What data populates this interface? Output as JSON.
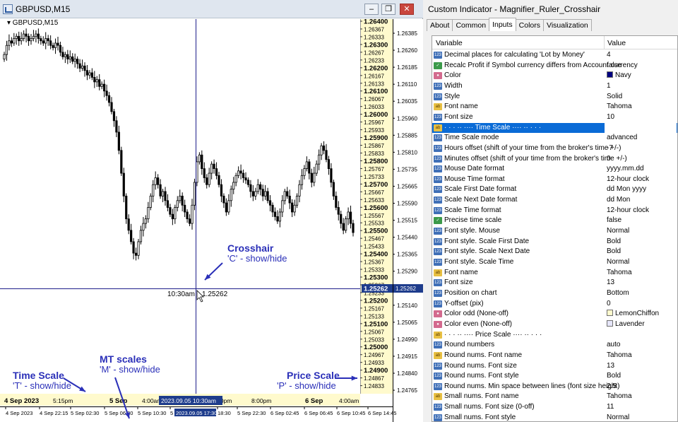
{
  "chart": {
    "window_title": "GBPUSD,M15",
    "symbol_label": "▾ GBPUSD,M15",
    "buttons": {
      "minimize": "–",
      "restore": "❐",
      "close": "✕"
    },
    "crosshair_time": "10:30am",
    "crosshair_price": "1.25262",
    "price_tag": "1.25262",
    "right_price_tag": "1.25262",
    "scale_marker": "2023.09.05 10:30am",
    "mt_marker": "2023.09.05 17:30",
    "custom_time_labels": [
      {
        "text": "4 Sep 2023",
        "bold": true
      },
      {
        "text": "5:15pm",
        "bold": false
      },
      {
        "text": "5 Sep",
        "bold": true
      },
      {
        "text": "4:00am",
        "bold": false
      },
      {
        "text": "4:00pm",
        "bold": false
      },
      {
        "text": "8:00pm",
        "bold": false
      },
      {
        "text": "6 Sep",
        "bold": true
      },
      {
        "text": "4:00am",
        "bold": false
      },
      {
        "text": "8:00am",
        "bold": false
      }
    ],
    "mt_time_labels": [
      "4 Sep 2023",
      "4 Sep 22:15",
      "5 Sep 02:30",
      "5 Sep 06:30",
      "5 Sep 10:30",
      "5",
      "18:30",
      "5 Sep 22:30",
      "6 Sep 02:45",
      "6 Sep 06:45",
      "6 Sep 10:45",
      "6 Sep 14:45"
    ],
    "custom_price_labels": [
      {
        "text": "1.26400",
        "bold": true
      },
      {
        "text": "1.26367",
        "bold": false
      },
      {
        "text": "1.26333",
        "bold": false
      },
      {
        "text": "1.26300",
        "bold": true
      },
      {
        "text": "1.26267",
        "bold": false
      },
      {
        "text": "1.26233",
        "bold": false
      },
      {
        "text": "1.26200",
        "bold": true
      },
      {
        "text": "1.26167",
        "bold": false
      },
      {
        "text": "1.26133",
        "bold": false
      },
      {
        "text": "1.26100",
        "bold": true
      },
      {
        "text": "1.26067",
        "bold": false
      },
      {
        "text": "1.26033",
        "bold": false
      },
      {
        "text": "1.26000",
        "bold": true
      },
      {
        "text": "1.25967",
        "bold": false
      },
      {
        "text": "1.25933",
        "bold": false
      },
      {
        "text": "1.25900",
        "bold": true
      },
      {
        "text": "1.25867",
        "bold": false
      },
      {
        "text": "1.25833",
        "bold": false
      },
      {
        "text": "1.25800",
        "bold": true
      },
      {
        "text": "1.25767",
        "bold": false
      },
      {
        "text": "1.25733",
        "bold": false
      },
      {
        "text": "1.25700",
        "bold": true
      },
      {
        "text": "1.25667",
        "bold": false
      },
      {
        "text": "1.25633",
        "bold": false
      },
      {
        "text": "1.25600",
        "bold": true
      },
      {
        "text": "1.25567",
        "bold": false
      },
      {
        "text": "1.25533",
        "bold": false
      },
      {
        "text": "1.25500",
        "bold": true
      },
      {
        "text": "1.25467",
        "bold": false
      },
      {
        "text": "1.25433",
        "bold": false
      },
      {
        "text": "1.25400",
        "bold": true
      },
      {
        "text": "1.25367",
        "bold": false
      },
      {
        "text": "1.25333",
        "bold": false
      },
      {
        "text": "1.25300",
        "bold": true
      },
      {
        "text": "1.25267",
        "bold": false
      },
      {
        "text": "1.25233",
        "bold": false
      },
      {
        "text": "1.25200",
        "bold": true
      },
      {
        "text": "1.25167",
        "bold": false
      },
      {
        "text": "1.25133",
        "bold": false
      },
      {
        "text": "1.25100",
        "bold": true
      },
      {
        "text": "1.25067",
        "bold": false
      },
      {
        "text": "1.25033",
        "bold": false
      },
      {
        "text": "1.25000",
        "bold": true
      },
      {
        "text": "1.24967",
        "bold": false
      },
      {
        "text": "1.24933",
        "bold": false
      },
      {
        "text": "1.24900",
        "bold": true
      },
      {
        "text": "1.24867",
        "bold": false
      },
      {
        "text": "1.24833",
        "bold": false
      }
    ],
    "mt_price_labels": [
      "1.26385",
      "1.26260",
      "1.26185",
      "1.26110",
      "1.26035",
      "1.25960",
      "1.25885",
      "1.25810",
      "1.25735",
      "1.25665",
      "1.25590",
      "1.25515",
      "1.25440",
      "1.25365",
      "1.25290",
      "1.25215",
      "1.25140",
      "1.25065",
      "1.24990",
      "1.24915",
      "1.24840",
      "1.24765"
    ],
    "annotations": {
      "crosshair_title": "Crosshair",
      "crosshair_sub": "'C' - show/hide",
      "mt_title": "MT scales",
      "mt_sub": "'M' - show/hide",
      "time_title": "Time Scale",
      "time_sub": "'T' - show/hide",
      "price_title": "Price Scale",
      "price_sub": "'P' - show/hide"
    },
    "colors": {
      "crosshair": "#1f1f8a",
      "candle": "#000000",
      "annotation": "#2a2fb8",
      "scale_bg": "#fffacd",
      "marker_bg": "#1e3c8c"
    }
  },
  "chart_data": {
    "type": "candlestick",
    "symbol": "GBPUSD",
    "timeframe": "M15",
    "closes": [
      1.2622,
      1.2626,
      1.2628,
      1.2627,
      1.2629,
      1.263,
      1.2628,
      1.2629,
      1.2631,
      1.263,
      1.2628,
      1.2629,
      1.263,
      1.2631,
      1.2629,
      1.2628,
      1.2627,
      1.2629,
      1.2628,
      1.2626,
      1.2625,
      1.2627,
      1.2626,
      1.2623,
      1.2621,
      1.2622,
      1.262,
      1.2621,
      1.2619,
      1.262,
      1.2618,
      1.2616,
      1.2617,
      1.2615,
      1.2613,
      1.2614,
      1.2612,
      1.261,
      1.2611,
      1.2608,
      1.2609,
      1.2606,
      1.2604,
      1.2601,
      1.2597,
      1.2593,
      1.2588,
      1.258,
      1.257,
      1.256,
      1.255,
      1.2545,
      1.254,
      1.2535,
      1.2534,
      1.254,
      1.2545,
      1.2548,
      1.255,
      1.2555,
      1.256,
      1.2565,
      1.2568,
      1.2565,
      1.256,
      1.2562,
      1.2558,
      1.2555,
      1.2552,
      1.255,
      1.2555,
      1.2558,
      1.256,
      1.2556,
      1.2553,
      1.255,
      1.2548,
      1.2556,
      1.2566,
      1.2575,
      1.2578,
      1.2572,
      1.2568,
      1.2565,
      1.257,
      1.2574,
      1.2572,
      1.2569,
      1.2565,
      1.256,
      1.2557,
      1.2553,
      1.2558,
      1.2563,
      1.2566,
      1.2569,
      1.2571,
      1.257,
      1.2568,
      1.2567,
      1.2565,
      1.2562,
      1.256,
      1.2562,
      1.2565,
      1.2563,
      1.256,
      1.2562,
      1.2558,
      1.2556,
      1.2553,
      1.2551,
      1.2549,
      1.2553,
      1.2558,
      1.2562,
      1.256,
      1.2557,
      1.2553,
      1.2556,
      1.256,
      1.2565,
      1.2569,
      1.2572,
      1.2575,
      1.257,
      1.2566,
      1.257,
      1.2574,
      1.2578,
      1.2582,
      1.258,
      1.2576,
      1.2572,
      1.2566,
      1.256,
      1.2555,
      1.2552,
      1.2548,
      1.2545,
      1.255,
      1.2553,
      1.2548,
      1.2544
    ],
    "price_range": [
      1.24765,
      1.264
    ],
    "crosshair": {
      "time": "10:30am",
      "price": 1.25262
    }
  },
  "dialog": {
    "title": "Custom Indicator - Magnifier_Ruler_Crosshair",
    "tabs": [
      "About",
      "Common",
      "Inputs",
      "Colors",
      "Visualization"
    ],
    "active_tab": 2,
    "col_variable": "Variable",
    "col_value": "Value",
    "rows": [
      {
        "icon": "num",
        "icon_text": "123",
        "name": "Decimal places for calculating 'Lot by Money'",
        "value": "4"
      },
      {
        "icon": "bool",
        "icon_text": "✓",
        "name": "Recalc Profit if Symbol currency differs from Account currency",
        "value": "false"
      },
      {
        "icon": "clr",
        "icon_text": "●",
        "name": "Color",
        "value": "Navy",
        "swatch": "#000080"
      },
      {
        "icon": "num",
        "icon_text": "123",
        "name": "Width",
        "value": "1"
      },
      {
        "icon": "num",
        "icon_text": "123",
        "name": "Style",
        "value": "Solid"
      },
      {
        "icon": "ab",
        "icon_text": "ab",
        "name": "Font name",
        "value": "Tahoma"
      },
      {
        "icon": "num",
        "icon_text": "123",
        "name": "Font size",
        "value": "10"
      },
      {
        "icon": "ab",
        "icon_text": "ab",
        "name": "·  ·  · ·· ···· Time Scale ···· ·· ·  ·  ·",
        "value": "",
        "highlight": true
      },
      {
        "icon": "num",
        "icon_text": "123",
        "name": "Time Scale mode",
        "value": "advanced"
      },
      {
        "icon": "num",
        "icon_text": "123",
        "name": "Hours offset (shift of your time from the broker's time +/-)",
        "value": "-7"
      },
      {
        "icon": "num",
        "icon_text": "123",
        "name": "Minutes offset (shift of your time from the broker's time +/-)",
        "value": "0"
      },
      {
        "icon": "num",
        "icon_text": "123",
        "name": "Mouse Date format",
        "value": "yyyy.mm.dd"
      },
      {
        "icon": "num",
        "icon_text": "123",
        "name": "Mouse Time format",
        "value": "12-hour clock"
      },
      {
        "icon": "num",
        "icon_text": "123",
        "name": "Scale First Date format",
        "value": "dd Mon yyyy"
      },
      {
        "icon": "num",
        "icon_text": "123",
        "name": "Scale Next Date format",
        "value": "dd Mon"
      },
      {
        "icon": "num",
        "icon_text": "123",
        "name": "Scale Time format",
        "value": "12-hour clock"
      },
      {
        "icon": "bool",
        "icon_text": "✓",
        "name": "Precise time scale",
        "value": "false"
      },
      {
        "icon": "num",
        "icon_text": "123",
        "name": "Font style. Mouse",
        "value": "Normal"
      },
      {
        "icon": "num",
        "icon_text": "123",
        "name": "Font style. Scale First Date",
        "value": "Bold"
      },
      {
        "icon": "num",
        "icon_text": "123",
        "name": "Font style. Scale Next Date",
        "value": "Bold"
      },
      {
        "icon": "num",
        "icon_text": "123",
        "name": "Font style. Scale Time",
        "value": "Normal"
      },
      {
        "icon": "ab",
        "icon_text": "ab",
        "name": "Font name",
        "value": "Tahoma"
      },
      {
        "icon": "num",
        "icon_text": "123",
        "name": "Font size",
        "value": "13"
      },
      {
        "icon": "num",
        "icon_text": "123",
        "name": "Position on chart",
        "value": "Bottom"
      },
      {
        "icon": "num",
        "icon_text": "123",
        "name": "Y-offset (pix)",
        "value": "0"
      },
      {
        "icon": "clr",
        "icon_text": "●",
        "name": "Color odd (None-off)",
        "value": "LemonChiffon",
        "swatch": "#fffacd"
      },
      {
        "icon": "clr",
        "icon_text": "●",
        "name": "Color even (None-off)",
        "value": "Lavender",
        "swatch": "#e6e6fa"
      },
      {
        "icon": "ab",
        "icon_text": "ab",
        "name": "·  ·  · ·· ···· Price Scale ···· ·· ·  ·  ·",
        "value": ""
      },
      {
        "icon": "num",
        "icon_text": "123",
        "name": "Round numbers",
        "value": "auto"
      },
      {
        "icon": "ab",
        "icon_text": "ab",
        "name": "Round nums. Font name",
        "value": "Tahoma"
      },
      {
        "icon": "num",
        "icon_text": "123",
        "name": "Round nums. Font size",
        "value": "13"
      },
      {
        "icon": "num",
        "icon_text": "123",
        "name": "Round nums. Font style",
        "value": "Bold"
      },
      {
        "icon": "num",
        "icon_text": "123",
        "name": "Round nums. Min space between lines (font size height)",
        "value": "2.5"
      },
      {
        "icon": "ab",
        "icon_text": "ab",
        "name": "Small nums. Font name",
        "value": "Tahoma"
      },
      {
        "icon": "num",
        "icon_text": "123",
        "name": "Small nums. Font size (0-off)",
        "value": "11"
      },
      {
        "icon": "num",
        "icon_text": "123",
        "name": "Small nums. Font style",
        "value": "Normal"
      }
    ]
  }
}
